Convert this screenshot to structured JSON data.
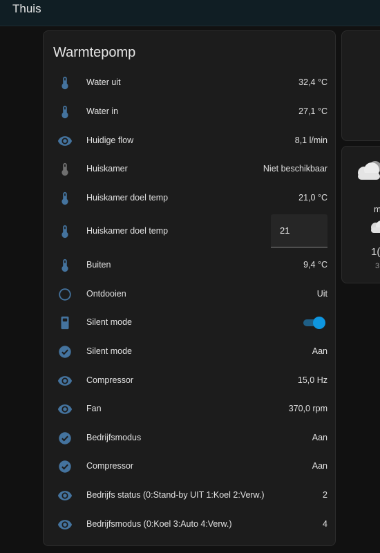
{
  "app": {
    "title": "Thuis"
  },
  "card": {
    "title": "Warmtepomp",
    "rows": [
      {
        "label": "Water uit",
        "value": "32,4 °C",
        "icon": "thermometer-icon"
      },
      {
        "label": "Water in",
        "value": "27,1 °C",
        "icon": "thermometer-icon"
      },
      {
        "label": "Huidige flow",
        "value": "8,1 l/min",
        "icon": "eye-icon"
      },
      {
        "label": "Huiskamer",
        "value": "Niet beschikbaar",
        "icon": "thermometer-icon"
      },
      {
        "label": "Huiskamer doel temp",
        "value": "21,0 °C",
        "icon": "thermometer-icon"
      },
      {
        "label": "Huiskamer doel temp",
        "value": "21",
        "icon": "thermometer-icon"
      },
      {
        "label": "Buiten",
        "value": "9,4 °C",
        "icon": "thermometer-icon"
      },
      {
        "label": "Ontdooien",
        "value": "Uit",
        "icon": "circle-outline-icon"
      },
      {
        "label": "Silent mode",
        "value": "on",
        "icon": "remote-icon"
      },
      {
        "label": "Silent mode",
        "value": "Aan",
        "icon": "check-circle-icon"
      },
      {
        "label": "Compressor",
        "value": "15,0 Hz",
        "icon": "eye-icon"
      },
      {
        "label": "Fan",
        "value": "370,0 rpm",
        "icon": "eye-icon"
      },
      {
        "label": "Bedrijfsmodus",
        "value": "Aan",
        "icon": "check-circle-icon"
      },
      {
        "label": "Compressor",
        "value": "Aan",
        "icon": "check-circle-icon"
      },
      {
        "label": "Bedrijfs status (0:Stand-by UIT 1:Koel 2:Verw.)",
        "value": "2",
        "icon": "eye-icon"
      },
      {
        "label": "Bedrijfsmodus (0:Koel 3:Auto 4:Verw.)",
        "value": "4",
        "icon": "eye-icon"
      }
    ]
  },
  "weather": {
    "label_fragment": "m",
    "value_fragment": "1(",
    "small_fragment": "3"
  },
  "colors": {
    "icon": "#44739e",
    "unavailable_icon": "#6f6f6f",
    "toggle_on": "#0e96e0",
    "background": "#111111",
    "card": "#1c1c1c"
  }
}
